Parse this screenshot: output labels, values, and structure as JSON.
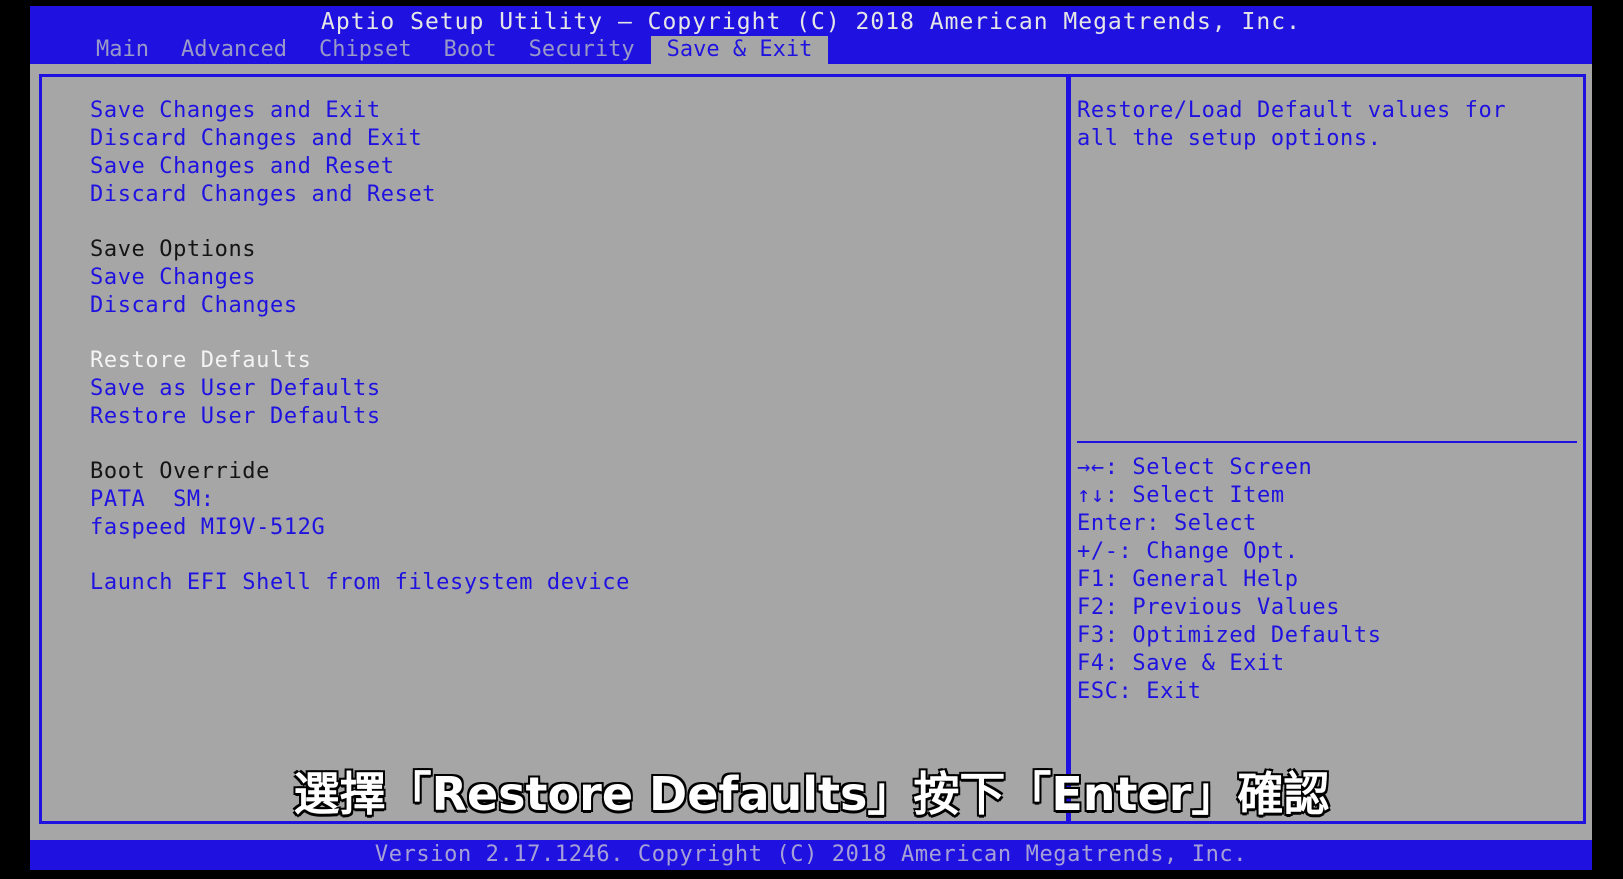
{
  "header": {
    "title": "Aptio Setup Utility – Copyright (C) 2018 American Megatrends, Inc.",
    "tabs": [
      {
        "label": "Main"
      },
      {
        "label": "Advanced"
      },
      {
        "label": "Chipset"
      },
      {
        "label": "Boot"
      },
      {
        "label": "Security"
      },
      {
        "label": "Save & Exit",
        "active": true
      }
    ]
  },
  "menu": {
    "save_changes_and_exit": "Save Changes and Exit",
    "discard_changes_and_exit": "Discard Changes and Exit",
    "save_changes_and_reset": "Save Changes and Reset",
    "discard_changes_and_reset": "Discard Changes and Reset",
    "save_options_heading": "Save Options",
    "save_changes": "Save Changes",
    "discard_changes": "Discard Changes",
    "restore_defaults": "Restore Defaults",
    "save_as_user_defaults": "Save as User Defaults",
    "restore_user_defaults": "Restore User Defaults",
    "boot_override_heading": "Boot Override",
    "pata_sm": "PATA  SM:",
    "faspeed": "faspeed MI9V-512G",
    "launch_efi_shell": "Launch EFI Shell from filesystem device"
  },
  "help": {
    "text": "Restore/Load Default values for all the setup options."
  },
  "keys": [
    {
      "key": "→←:",
      "action": "Select Screen"
    },
    {
      "key": "↑↓:",
      "action": "Select Item"
    },
    {
      "key": "Enter:",
      "action": "Select"
    },
    {
      "key": "+/-:",
      "action": "Change Opt."
    },
    {
      "key": "F1:",
      "action": "General Help"
    },
    {
      "key": "F2:",
      "action": "Previous Values"
    },
    {
      "key": "F3:",
      "action": "Optimized Defaults"
    },
    {
      "key": "F4:",
      "action": "Save & Exit"
    },
    {
      "key": "ESC:",
      "action": "Exit"
    }
  ],
  "footer": {
    "version": "Version 2.17.1246. Copyright (C) 2018 American Megatrends, Inc."
  },
  "subtitle": "選擇「Restore Defaults」按下「Enter」確認",
  "colors": {
    "bios_blue": "#1f12e0",
    "panel_gray": "#a6a6a6",
    "selected_white": "#f4f4f4"
  }
}
